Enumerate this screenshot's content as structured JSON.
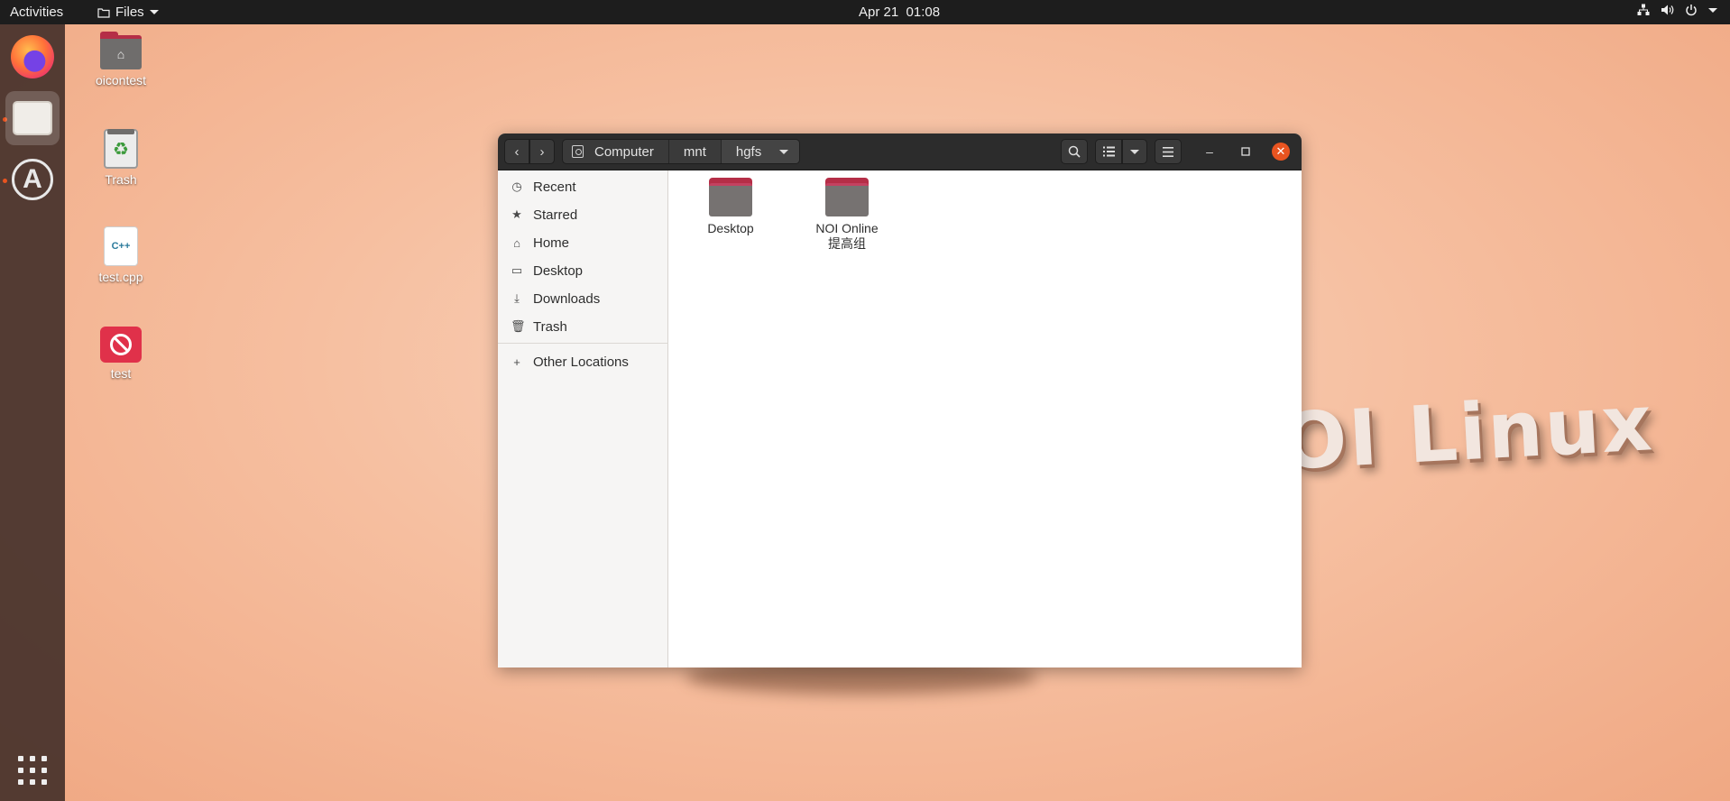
{
  "topbar": {
    "activities": "Activities",
    "app_menu": "Files",
    "clock": "Apr 21  01:08"
  },
  "desktop": {
    "icons": [
      {
        "label": "oicontest",
        "icon": "home-folder-icon"
      },
      {
        "label": "Trash",
        "icon": "trash-icon"
      },
      {
        "label": "test.cpp",
        "icon": "cpp-file-icon",
        "glyph": "C++"
      },
      {
        "label": "test",
        "icon": "broken-executable-icon"
      }
    ],
    "wallpaper_text": "OI Linux"
  },
  "window": {
    "breadcrumbs": [
      "Computer",
      "mnt",
      "hgfs"
    ],
    "sidebar": {
      "items": [
        {
          "label": "Recent",
          "icon": "clock-icon"
        },
        {
          "label": "Starred",
          "icon": "star-icon"
        },
        {
          "label": "Home",
          "icon": "home-icon"
        },
        {
          "label": "Desktop",
          "icon": "desktop-icon"
        },
        {
          "label": "Downloads",
          "icon": "download-icon"
        },
        {
          "label": "Trash",
          "icon": "trash-icon"
        }
      ],
      "other_locations": "Other Locations"
    },
    "folders": [
      {
        "label": "Desktop"
      },
      {
        "label": "NOI Online\n提高组"
      }
    ]
  },
  "colors": {
    "accent": "#e95420",
    "folder_tab": "#b52e47",
    "topbar": "#1d1d1d"
  }
}
